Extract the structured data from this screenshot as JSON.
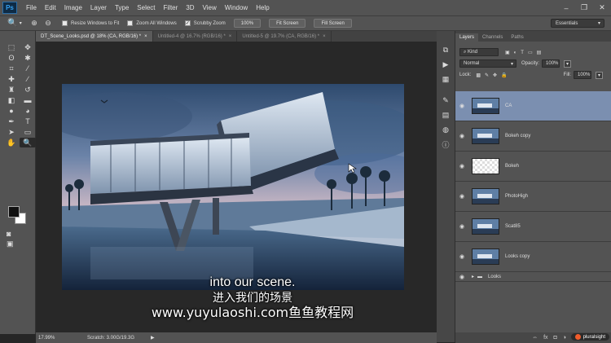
{
  "app": {
    "logo": "Ps"
  },
  "menu": [
    "File",
    "Edit",
    "Image",
    "Layer",
    "Type",
    "Select",
    "Filter",
    "3D",
    "View",
    "Window",
    "Help"
  ],
  "window_controls": [
    "–",
    "❐",
    "✕"
  ],
  "options": {
    "tool_icon": "zoom-tool-icon",
    "zoom_in": "⊕",
    "zoom_out": "⊖",
    "resize_windows": "Resize Windows to Fit",
    "zoom_all": "Zoom All Windows",
    "scrubby": "Scrubby Zoom",
    "btn_100": "100%",
    "fit_screen": "Fit Screen",
    "fill_screen": "Fill Screen",
    "workspace": "Essentials"
  },
  "tabs": [
    {
      "label": "DT_Scene_Looks.psd @ 18% (CA, RGB/16) *",
      "active": true
    },
    {
      "label": "Untitled-4 @ 16.7% (RGB/16) *",
      "active": false
    },
    {
      "label": "Untitled-5 @ 19.7% (CA, RGB/16) *",
      "active": false
    }
  ],
  "tab_close": "×",
  "status": {
    "zoom": "17.99%",
    "scratch": "Scratch: 3.00G/19.3G",
    "arrow": "▶"
  },
  "subtitles": {
    "en": "into our scene.",
    "zh": "进入我们的场景",
    "url": "www.yuyulaoshi.com鱼鱼教程网"
  },
  "panel": {
    "tabs": [
      "Layers",
      "Channels",
      "Paths"
    ],
    "kind": "Kind",
    "blend": "Normal",
    "opacity_label": "Opacity:",
    "opacity": "100%",
    "lock_label": "Lock:",
    "fill_label": "Fill:",
    "fill": "100%",
    "layers": [
      {
        "name": "CA",
        "active": true,
        "type": "photo"
      },
      {
        "name": "Bokeh copy",
        "active": false,
        "type": "photo"
      },
      {
        "name": "Bokeh",
        "active": false,
        "type": "transparent"
      },
      {
        "name": "PhotoHigh",
        "active": false,
        "type": "photo"
      },
      {
        "name": "Scat85",
        "active": false,
        "type": "photo"
      },
      {
        "name": "Looks copy",
        "active": false,
        "type": "photo"
      }
    ],
    "group": "Looks",
    "footer_icons": [
      "⇔",
      "fx",
      "◘",
      "◑",
      "▭",
      "▤",
      "🗑"
    ]
  },
  "brand": "pluralsight",
  "colors": {
    "accent_layer": "#7b8fb0",
    "chrome": "#535353",
    "canvas_bg": "#282828"
  }
}
